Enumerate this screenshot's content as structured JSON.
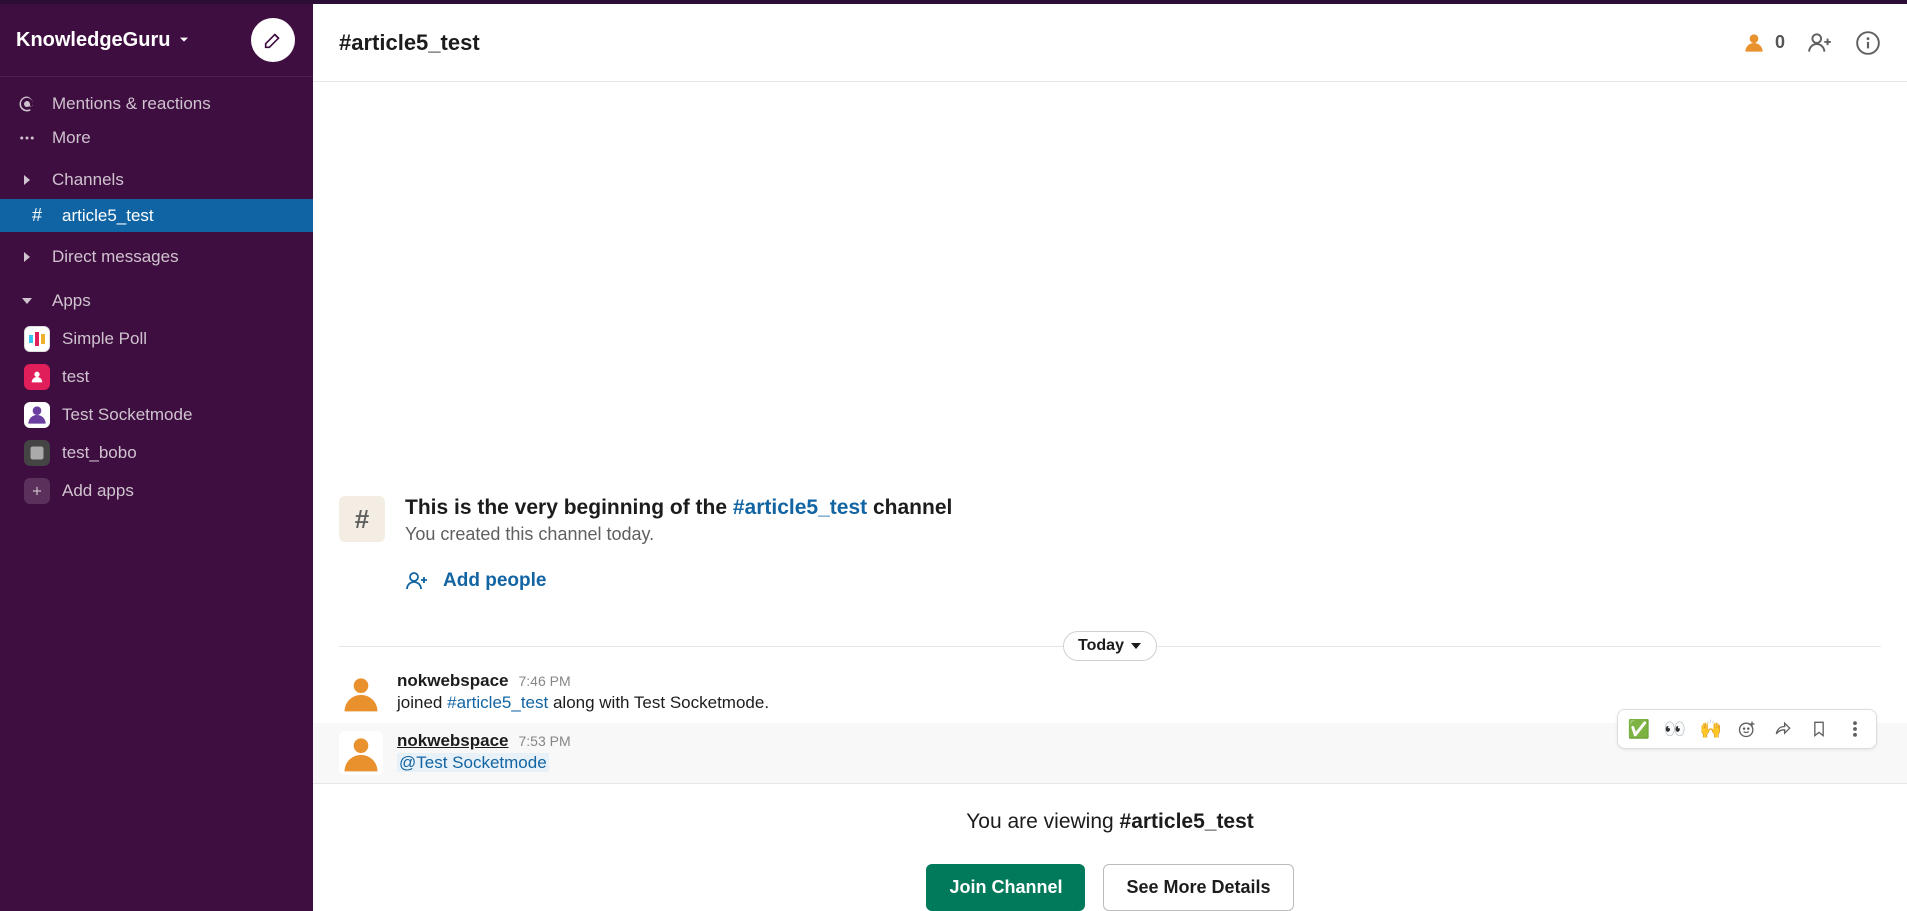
{
  "workspace": {
    "name": "KnowledgeGuru"
  },
  "sidebar": {
    "mentions": "Mentions & reactions",
    "more": "More",
    "channels_header": "Channels",
    "channels": [
      {
        "name": "article5_test",
        "selected": true
      }
    ],
    "direct_header": "Direct messages",
    "apps_header": "Apps",
    "apps": [
      {
        "name": "Simple Poll"
      },
      {
        "name": "test"
      },
      {
        "name": "Test Socketmode"
      },
      {
        "name": "test_bobo"
      }
    ],
    "add_apps": "Add apps"
  },
  "header": {
    "channel_title": "#article5_test",
    "member_count": "0"
  },
  "welcome": {
    "prefix": "This is the very beginning of the ",
    "channel": "#article5_test",
    "suffix": " channel",
    "subline": "You created this channel today.",
    "add_people": "Add people"
  },
  "divider": {
    "label": "Today"
  },
  "messages": [
    {
      "user": "nokwebspace",
      "time": "7:46 PM",
      "text_plain_prefix": "joined ",
      "text_chan": "#article5_test",
      "text_plain_suffix": " along with Test Socketmode."
    },
    {
      "user": "nokwebspace",
      "time": "7:53 PM",
      "mention": "@Test Socketmode"
    }
  ],
  "hover_actions": {
    "check": "✅",
    "eyes": "👀",
    "raised": "🙌"
  },
  "footer": {
    "viewing_prefix": "You are viewing ",
    "viewing_channel": "#article5_test",
    "join": "Join Channel",
    "details": "See More Details"
  }
}
